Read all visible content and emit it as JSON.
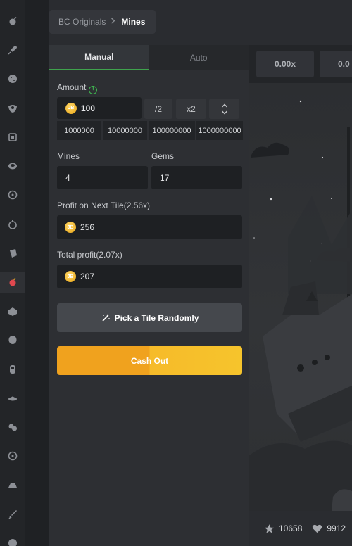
{
  "breadcrumb": {
    "parent": "BC Originals",
    "separator": ">",
    "current": "Mines"
  },
  "tabs": [
    {
      "label": "Manual",
      "active": true
    },
    {
      "label": "Auto",
      "active": false
    }
  ],
  "amount": {
    "label": "Amount",
    "value": "100",
    "coin": "JB",
    "half_label": "/2",
    "double_label": "x2",
    "quick_values": [
      "1000000",
      "10000000",
      "100000000",
      "1000000000"
    ]
  },
  "mines": {
    "label": "Mines",
    "value": "4"
  },
  "gems": {
    "label": "Gems",
    "value": "17"
  },
  "profit_next": {
    "label": "Profit on Next Tile(2.56x)",
    "value": "256",
    "coin": "JB"
  },
  "total_profit": {
    "label": "Total profit(2.07x)",
    "value": "207",
    "coin": "JB"
  },
  "buttons": {
    "random_tile": "Pick a Tile Randomly",
    "cash_out": "Cash Out"
  },
  "multipliers": [
    "0.00x",
    "0.0"
  ],
  "stats": {
    "favorites": "10658",
    "likes": "9912"
  },
  "sidebar_icons": [
    "bomb-icon",
    "rocket-icon",
    "dice-icon",
    "crash-icon",
    "square-icon",
    "coin-flip-icon",
    "wheel-icon",
    "limbo-icon",
    "hand-icon",
    "mines-icon",
    "plinko-icon",
    "egg-icon",
    "mask-icon",
    "ufo-icon",
    "coins-icon",
    "compass-icon",
    "hat-icon",
    "sword-icon",
    "circle-icon"
  ],
  "colors": {
    "accent_green": "#3fa34d",
    "cash_out_orange": "#f0a21e",
    "cash_out_yellow": "#f6c42c",
    "coin_gold": "#f0b429"
  }
}
